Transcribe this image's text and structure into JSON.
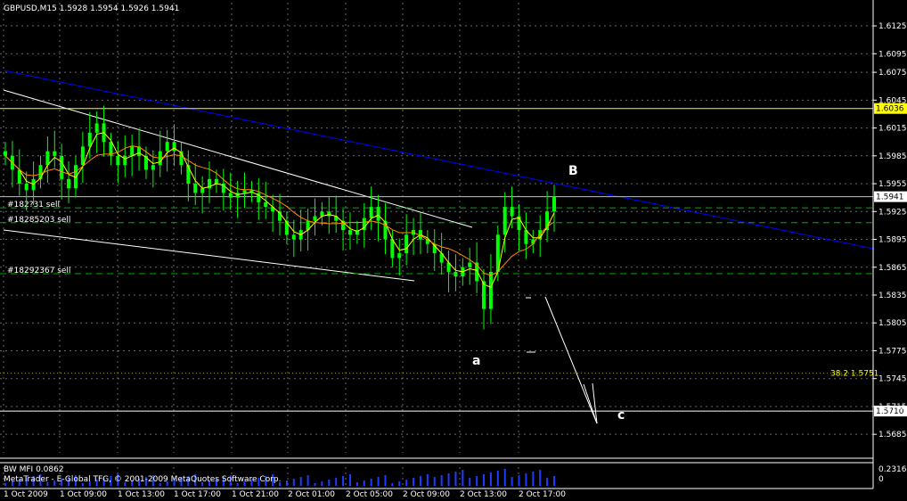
{
  "header": {
    "symbol_text": "GBPUSD,M15  1.5928 1.5954 1.5926 1.5941"
  },
  "indicator": {
    "name_text": "BW MFI 0.0862",
    "copyright_text": "MetaTrader - E-Global TFG, © 2001-2009 MetaQuotes Software Corp.",
    "scale_top": "0.2316",
    "scale_bottom": "0"
  },
  "colors": {
    "background": "#000000",
    "grid": "#c0c0c0",
    "candles": "#00ff00",
    "ma_fast": "#ffff00",
    "ma_slow": "#ff8c00",
    "trendline_blue": "#0000ff",
    "level_line": "#ffff00",
    "order_line": "#00aa00",
    "volume_bar": "#1e3cff"
  },
  "chart_data": {
    "type": "candlestick",
    "symbol": "GBPUSD",
    "timeframe": "M15",
    "last_ohlc": {
      "open": 1.5928,
      "high": 1.5954,
      "low": 1.5926,
      "close": 1.5941
    },
    "ylim": [
      1.5665,
      1.615
    ],
    "y_ticks": [
      "1.6125",
      "1.6095",
      "1.6075",
      "1.6045",
      "1.6015",
      "1.5985",
      "1.5955",
      "1.5925",
      "1.5895",
      "1.5865",
      "1.5835",
      "1.5805",
      "1.5775",
      "1.5745",
      "1.5715",
      "1.5685"
    ],
    "x_ticks": [
      "1 Oct 2009",
      "1 Oct 09:00",
      "1 Oct 13:00",
      "1 Oct 17:00",
      "1 Oct 21:00",
      "2 Oct 01:00",
      "2 Oct 05:00",
      "2 Oct 09:00",
      "2 Oct 13:00",
      "2 Oct 17:00"
    ],
    "closes": [
      1.5985,
      1.597,
      1.5955,
      1.5948,
      1.596,
      1.5975,
      1.599,
      1.5985,
      1.596,
      1.595,
      1.5975,
      1.5995,
      1.601,
      1.602,
      1.6,
      1.5985,
      1.5975,
      1.5985,
      1.5995,
      1.5985,
      1.597,
      1.5975,
      1.599,
      1.6,
      1.599,
      1.5975,
      1.5955,
      1.5945,
      1.595,
      1.596,
      1.5955,
      1.5945,
      1.594,
      1.5945,
      1.5948,
      1.5945,
      1.5935,
      1.593,
      1.5925,
      1.5915,
      1.59,
      1.5895,
      1.5905,
      1.5915,
      1.592,
      1.5925,
      1.592,
      1.5915,
      1.5905,
      1.59,
      1.5905,
      1.5918,
      1.593,
      1.5915,
      1.5895,
      1.5875,
      1.588,
      1.59,
      1.5905,
      1.5895,
      1.589,
      1.588,
      1.587,
      1.586,
      1.5855,
      1.5865,
      1.587,
      1.585,
      1.582,
      1.586,
      1.59,
      1.593,
      1.592,
      1.5905,
      1.589,
      1.5895,
      1.5905,
      1.5925,
      1.5941
    ],
    "current_price_label": "1.5941",
    "levels": [
      {
        "label": "1.6036",
        "price": 1.6036,
        "color": "#ffff00"
      },
      {
        "label": "1.5710",
        "price": 1.571,
        "color": "#ffffff"
      }
    ],
    "orders": [
      {
        "label": "#182?31 sell",
        "price": 1.5929
      },
      {
        "label": "#18285203 sell",
        "price": 1.5913
      },
      {
        "label": "#18292367 sell",
        "price": 1.5858
      }
    ],
    "annotations": [
      {
        "text": "B",
        "style": "big"
      },
      {
        "text": "a",
        "style": "big"
      },
      {
        "text": "c",
        "style": "big"
      },
      {
        "text": "38.2 1.5751",
        "style": "fib"
      }
    ]
  }
}
